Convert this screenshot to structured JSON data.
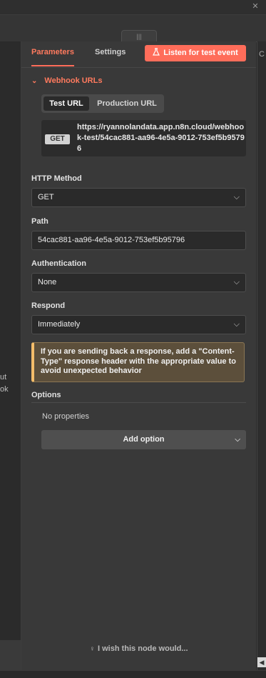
{
  "tabs": {
    "parameters": "Parameters",
    "settings": "Settings",
    "listen_button": "Listen for test event",
    "listen_icon": "flask-icon"
  },
  "webhook_urls": {
    "header": "Webhook URLs",
    "toggle": {
      "test": "Test URL",
      "production": "Production URL",
      "selected": "Test URL"
    },
    "method_badge": "GET",
    "url": "https://ryannolandata.app.n8n.cloud/webhook-test/54cac881-aa96-4e5a-9012-753ef5b95796"
  },
  "http_method": {
    "label": "HTTP Method",
    "value": "GET"
  },
  "path": {
    "label": "Path",
    "value": "54cac881-aa96-4e5a-9012-753ef5b95796"
  },
  "authentication": {
    "label": "Authentication",
    "value": "None"
  },
  "respond": {
    "label": "Respond",
    "value": "Immediately"
  },
  "notice": "If you are sending back a response, add a \"Content-Type\" response header with the appropriate value to avoid unexpected behavior",
  "options": {
    "label": "Options",
    "empty_text": "No properties",
    "add_option": "Add option"
  },
  "footer": {
    "wish": "I wish this node would...",
    "icon": "lightbulb-icon"
  },
  "left_pane": {
    "line1": "ut",
    "line2": "ok"
  },
  "colors": {
    "accent": "#ff6d5a",
    "panel": "#393939",
    "field": "#2a2a2a",
    "notice_bg": "#5c4f3b",
    "notice_border": "#f4bd6a"
  }
}
